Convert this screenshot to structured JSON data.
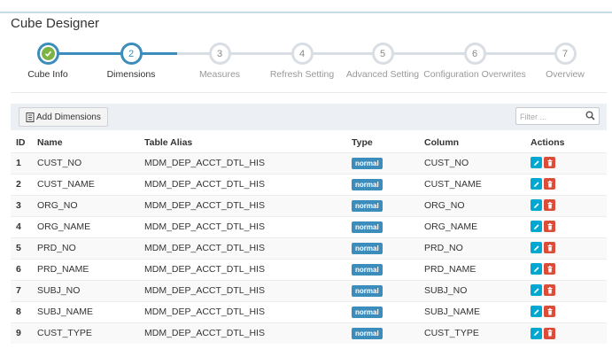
{
  "page": {
    "title": "Cube Designer"
  },
  "wizard": {
    "steps": [
      {
        "number": "1",
        "label": "Cube Info",
        "state": "done"
      },
      {
        "number": "2",
        "label": "Dimensions",
        "state": "active"
      },
      {
        "number": "3",
        "label": "Measures",
        "state": "todo"
      },
      {
        "number": "4",
        "label": "Refresh Setting",
        "state": "todo"
      },
      {
        "number": "5",
        "label": "Advanced Setting",
        "state": "todo"
      },
      {
        "number": "6",
        "label": "Configuration Overwrites",
        "state": "todo"
      },
      {
        "number": "7",
        "label": "Overview",
        "state": "todo"
      }
    ]
  },
  "toolbar": {
    "add_label": "Add Dimensions",
    "filter_placeholder": "Filter ..."
  },
  "table": {
    "headers": {
      "id": "ID",
      "name": "Name",
      "alias": "Table Alias",
      "type": "Type",
      "column": "Column",
      "actions": "Actions"
    },
    "rows": [
      {
        "id": "1",
        "name": "CUST_NO",
        "alias": "MDM_DEP_ACCT_DTL_HIS",
        "type": "normal",
        "column": "CUST_NO"
      },
      {
        "id": "2",
        "name": "CUST_NAME",
        "alias": "MDM_DEP_ACCT_DTL_HIS",
        "type": "normal",
        "column": "CUST_NAME"
      },
      {
        "id": "3",
        "name": "ORG_NO",
        "alias": "MDM_DEP_ACCT_DTL_HIS",
        "type": "normal",
        "column": "ORG_NO"
      },
      {
        "id": "4",
        "name": "ORG_NAME",
        "alias": "MDM_DEP_ACCT_DTL_HIS",
        "type": "normal",
        "column": "ORG_NAME"
      },
      {
        "id": "5",
        "name": "PRD_NO",
        "alias": "MDM_DEP_ACCT_DTL_HIS",
        "type": "normal",
        "column": "PRD_NO"
      },
      {
        "id": "6",
        "name": "PRD_NAME",
        "alias": "MDM_DEP_ACCT_DTL_HIS",
        "type": "normal",
        "column": "PRD_NAME"
      },
      {
        "id": "7",
        "name": "SUBJ_NO",
        "alias": "MDM_DEP_ACCT_DTL_HIS",
        "type": "normal",
        "column": "SUBJ_NO"
      },
      {
        "id": "8",
        "name": "SUBJ_NAME",
        "alias": "MDM_DEP_ACCT_DTL_HIS",
        "type": "normal",
        "column": "SUBJ_NAME"
      },
      {
        "id": "9",
        "name": "CUST_TYPE",
        "alias": "MDM_DEP_ACCT_DTL_HIS",
        "type": "normal",
        "column": "CUST_TYPE"
      }
    ]
  },
  "colors": {
    "accent": "#3c8dbc",
    "done_check": "#7cb342",
    "edit": "#00a7d0",
    "delete": "#dd4b39"
  },
  "icons": {
    "add": "add-dimension-icon",
    "search": "search-icon",
    "edit": "edit-icon",
    "delete": "trash-icon",
    "done": "check-icon"
  }
}
